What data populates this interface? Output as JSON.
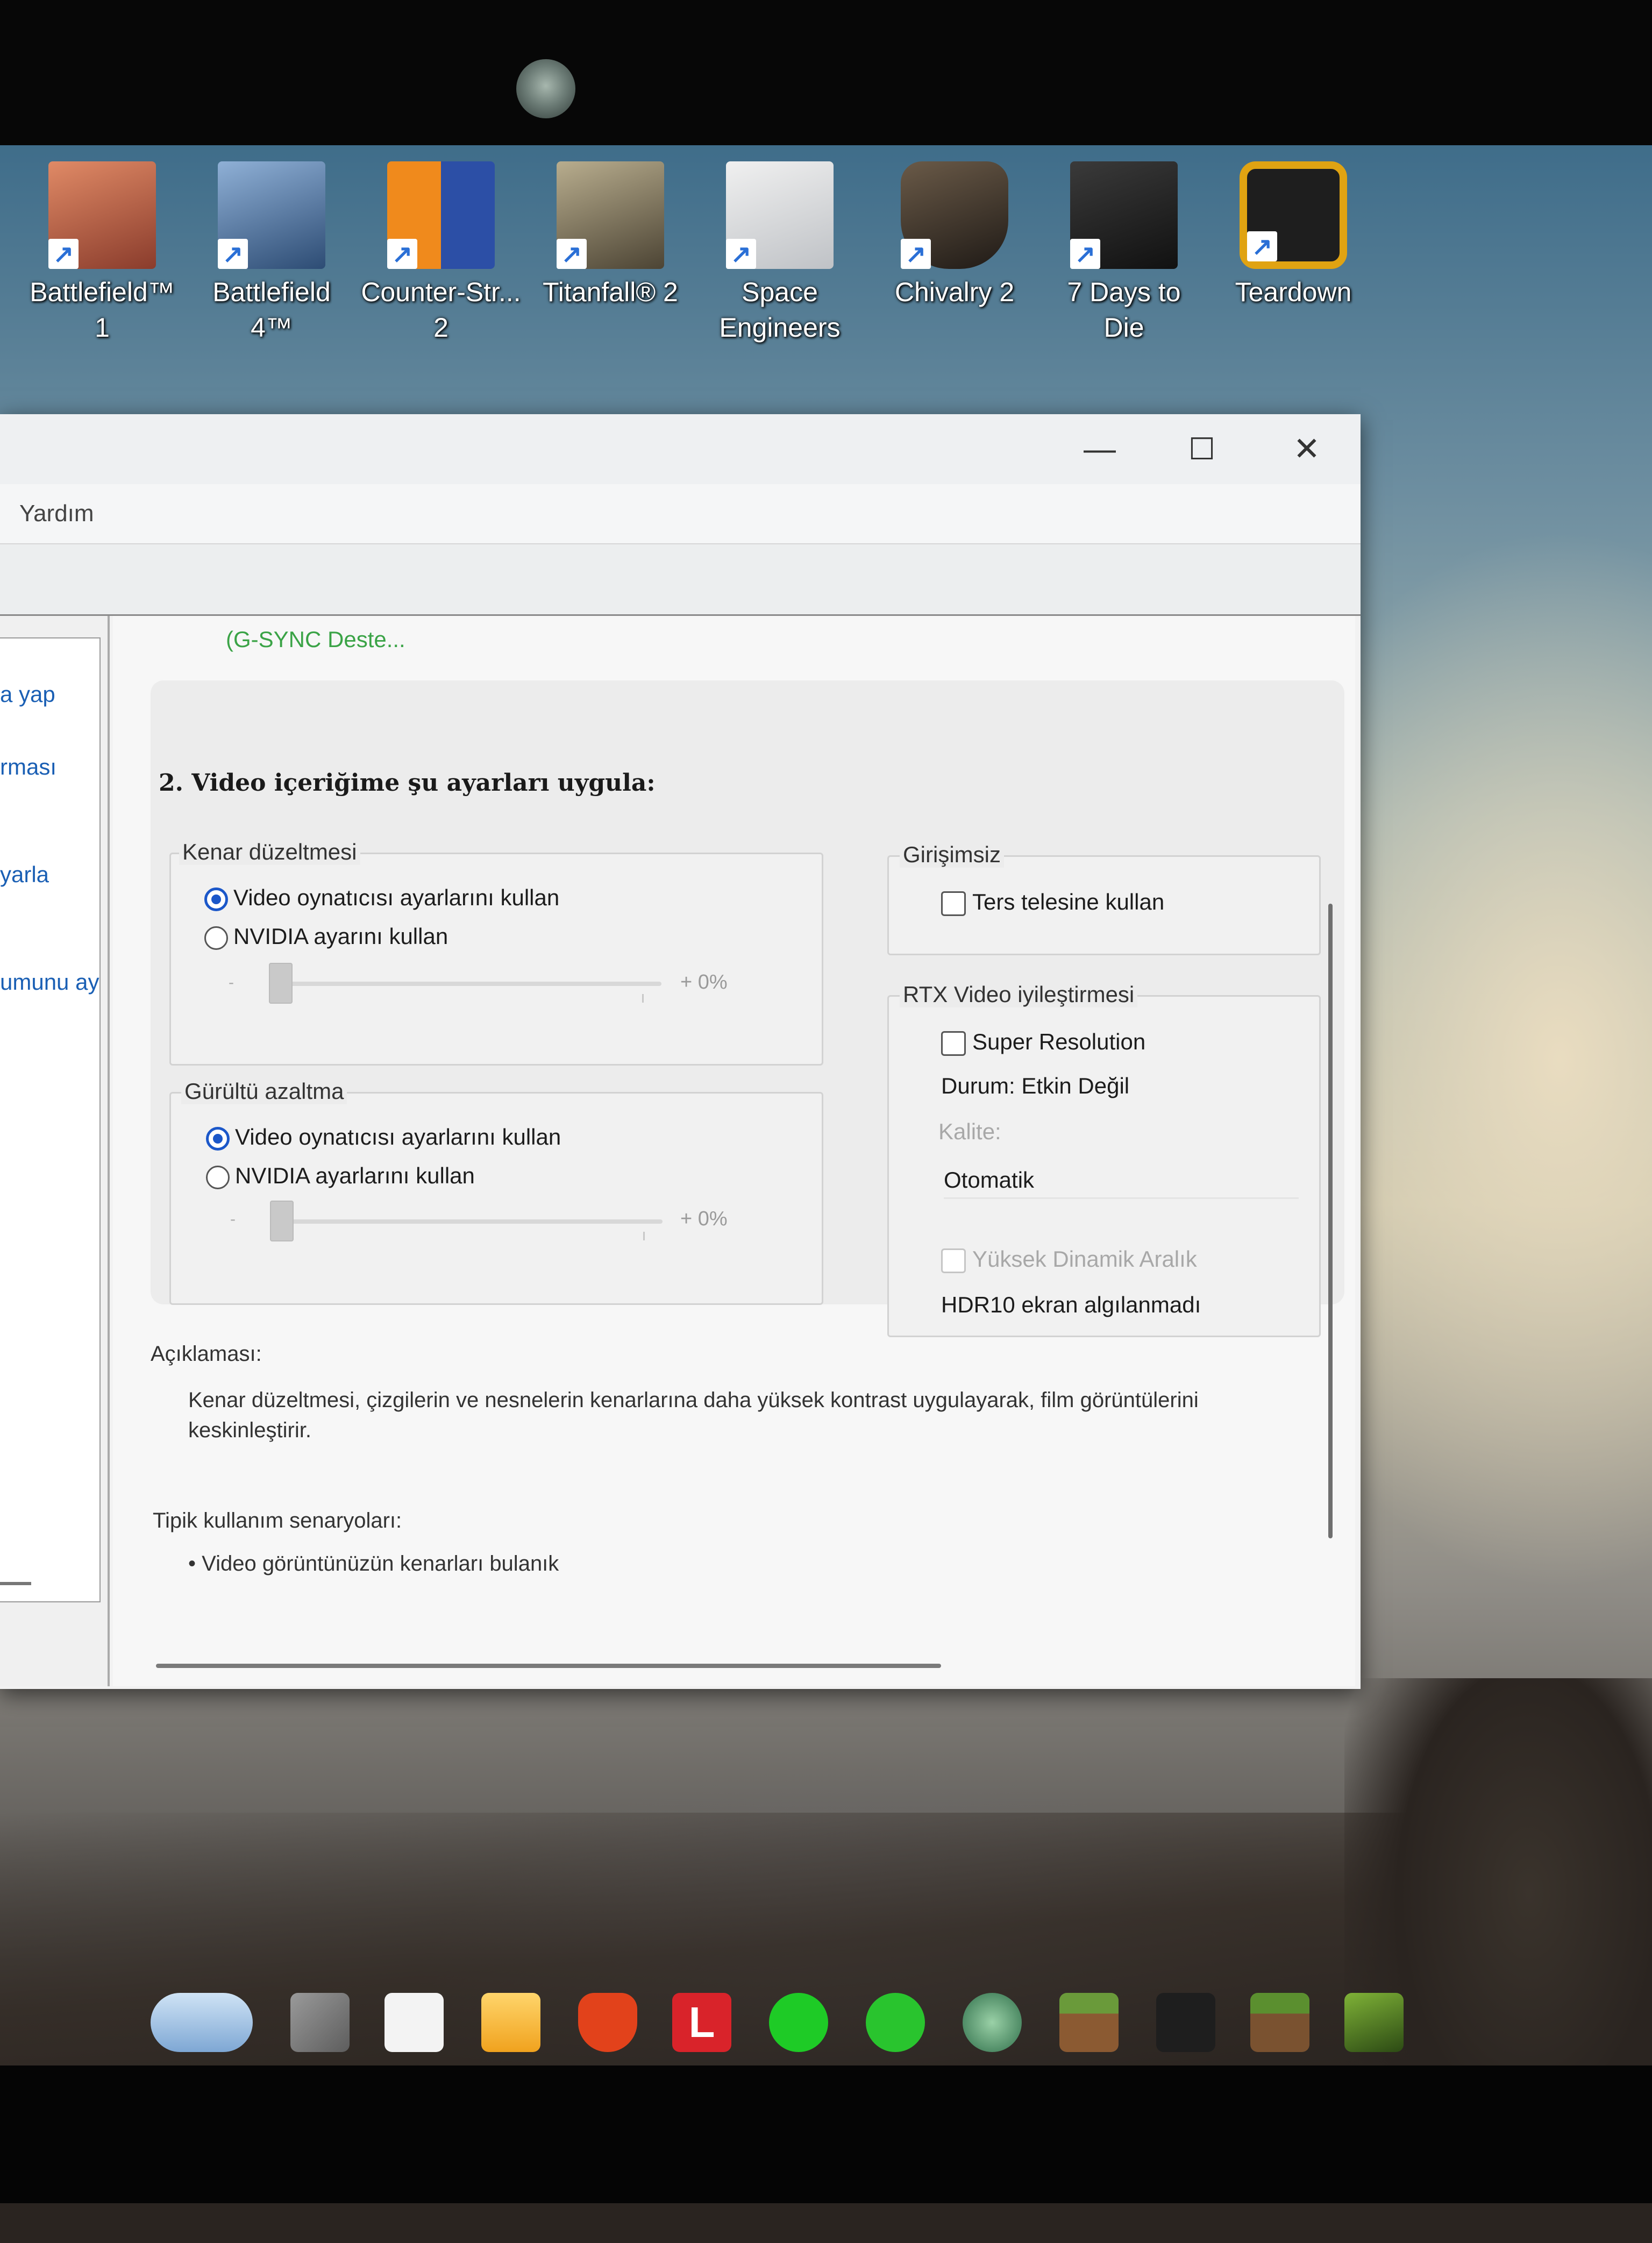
{
  "desktop_icons": [
    {
      "label": "Battlefield™ 1",
      "icon": "battlefield-1-icon",
      "color": "#b85b3e"
    },
    {
      "label": "Battlefield 4™",
      "icon": "battlefield-4-icon",
      "color": "#3d5f8a"
    },
    {
      "label": "Counter-Str... 2",
      "icon": "counter-strike-2-icon",
      "color": "#f08a1c"
    },
    {
      "label": "Titanfall® 2",
      "icon": "titanfall-2-icon",
      "color": "#8a7a5a"
    },
    {
      "label": "Space Engineers",
      "icon": "space-engineers-icon",
      "color": "#d0d3d6"
    },
    {
      "label": "Chivalry 2",
      "icon": "chivalry-2-icon",
      "color": "#3a3330"
    },
    {
      "label": "7 Days to Die",
      "icon": "7-days-to-die-icon",
      "color": "#1f1f1f"
    },
    {
      "label": "Teardown",
      "icon": "teardown-icon",
      "color": "#e0a312"
    }
  ],
  "window": {
    "menu_help": "Yardım",
    "minimize_glyph": "—",
    "maximize_glyph": "☐",
    "close_glyph": "✕"
  },
  "nav": {
    "items": [
      "a yap",
      "rması",
      "yarla",
      "umunu ay"
    ]
  },
  "content": {
    "gsync_link": "(G-SYNC Deste...",
    "step_title": "2. Video içeriğime şu ayarları uygula:",
    "edge": {
      "title": "Kenar düzeltmesi",
      "option_player": "Video oynatıcısı ayarlarını kullan",
      "option_nvidia": "NVIDIA ayarını kullan",
      "selected": "player",
      "slider_minus": "-",
      "slider_value": "+ 0%",
      "level": 0
    },
    "noise": {
      "title": "Gürültü azaltma",
      "option_player": "Video oynatıcısı ayarlarını kullan",
      "option_nvidia": "NVIDIA ayarlarını kullan",
      "selected": "player",
      "slider_minus": "-",
      "slider_value": "+ 0%",
      "level": 0
    },
    "inverse": {
      "title": "Girişimsiz",
      "checkbox_label": "Ters telesine kullan",
      "checked": false
    },
    "rtx": {
      "title": "RTX Video iyileştirmesi",
      "super_resolution_label": "Super Resolution",
      "super_resolution_checked": false,
      "status": "Durum: Etkin Değil",
      "quality_label": "Kalite:",
      "quality_value": "Otomatik",
      "hdr_label": "Yüksek Dinamik Aralık",
      "hdr_checked": false,
      "hdr_status": "HDR10 ekran algılanmadı"
    },
    "description_title": "Açıklaması:",
    "description_text": "Kenar düzeltmesi, çizgilerin ve nesnelerin kenarlarına daha yüksek kontrast uygulayarak, film görüntülerini keskinleştirir.",
    "usage_title": "Tipik kullanım senaryoları:",
    "usage_item": "• Video görüntünüzün kenarları bulanık"
  },
  "taskbar": [
    {
      "icon": "widgets-icon",
      "color": "#5a86c0",
      "glyph": ""
    },
    {
      "icon": "task-view-icon",
      "color": "#7a7a7a",
      "glyph": ""
    },
    {
      "icon": "microsoft-store-icon",
      "color": "#f3f3f3",
      "glyph": ""
    },
    {
      "icon": "file-explorer-icon",
      "color": "#f5b82e",
      "glyph": ""
    },
    {
      "icon": "brave-browser-icon",
      "color": "#e2421b",
      "glyph": ""
    },
    {
      "icon": "l-app-icon",
      "color": "#d9232a",
      "glyph": "L"
    },
    {
      "icon": "razer-cortex-icon",
      "color": "#1ecb26",
      "glyph": ""
    },
    {
      "icon": "razer-synapse-icon",
      "color": "#29c42e",
      "glyph": ""
    },
    {
      "icon": "razer-gamebooster-icon",
      "color": "#4e9c6e",
      "glyph": ""
    },
    {
      "icon": "minecraft-icon",
      "color": "#6a9a3a",
      "glyph": ""
    },
    {
      "icon": "anvil-app-icon",
      "color": "#1e1e1e",
      "glyph": ""
    },
    {
      "icon": "minecraft-launcher-icon",
      "color": "#5b8f2f",
      "glyph": ""
    },
    {
      "icon": "nvidia-control-panel-icon",
      "color": "#6b9a2a",
      "glyph": ""
    }
  ]
}
